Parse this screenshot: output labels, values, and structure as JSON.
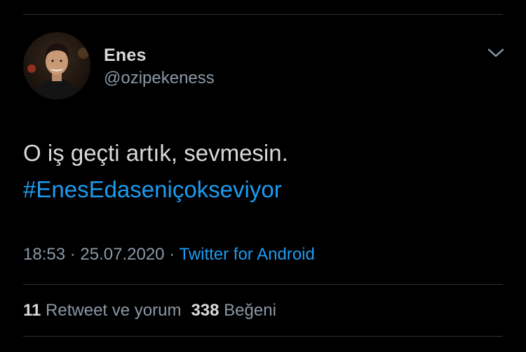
{
  "tweet": {
    "author": {
      "display_name": "Enes",
      "username": "@ozipekeness",
      "avatar_icon": "user-avatar-photo"
    },
    "menu_icon": "chevron-down-icon",
    "text": "O iş geçti artık, sevmesin.",
    "hashtag": "#EnesEdaseniçokseviyor",
    "time": "18:53",
    "date": "25.07.2020",
    "separator": "·",
    "source": "Twitter for Android",
    "stats": {
      "retweets_count": "11",
      "retweets_label": "Retweet ve yorum",
      "likes_count": "338",
      "likes_label": "Beğeni"
    }
  },
  "colors": {
    "background": "#000000",
    "primary_text": "#d9d9d9",
    "secondary_text": "#8b98a5",
    "link": "#1d9bf0",
    "divider": "#2f3336"
  }
}
